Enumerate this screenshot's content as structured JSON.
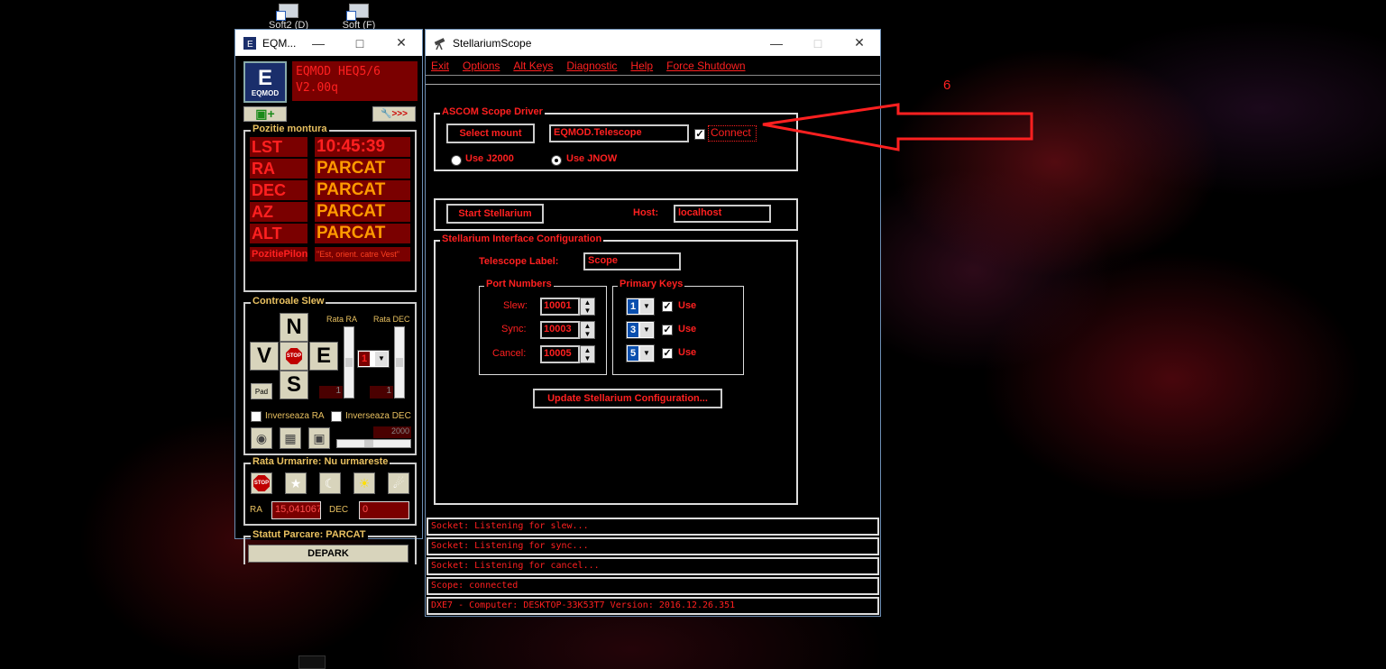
{
  "desktop": {
    "icons": [
      {
        "label": "Soft2 (D)"
      },
      {
        "label": "Soft (F)"
      }
    ],
    "annotation_number": "6",
    "colors": {
      "arrow": "#ff2020"
    }
  },
  "eqmod": {
    "window_title": "EQM...",
    "title_line1": "EQMOD HEQ5/6",
    "title_line2": "V2.00q",
    "logo_letter": "E",
    "logo_label": "EQMOD",
    "settings_btn_label": ">>>",
    "position": {
      "title": "Pozitie montura",
      "rows": [
        {
          "label": "LST",
          "value": "10:45:39"
        },
        {
          "label": "RA",
          "value": "PARCAT"
        },
        {
          "label": "DEC",
          "value": "PARCAT"
        },
        {
          "label": "AZ",
          "value": "PARCAT"
        },
        {
          "label": "ALT",
          "value": "PARCAT"
        }
      ],
      "pier_label": "PozitiePilon",
      "pier_value": "\"Est, orient. catre Vest\""
    },
    "slew": {
      "title": "Controale Slew",
      "n": "N",
      "s": "S",
      "e": "E",
      "w": "V",
      "stop": "STOP",
      "pad": "Pad",
      "rate_ra_label": "Rata RA",
      "rate_dec_label": "Rata DEC",
      "rate_combo_value": "1",
      "rate_ra_value": "1",
      "rate_dec_value": "1",
      "reverse_ra": "Inverseaza RA",
      "reverse_dec": "Inverseaza DEC",
      "slider_value": "2000"
    },
    "tracking": {
      "title": "Rata Urmarire: Nu urmareste",
      "stop": "STOP",
      "ra_label": "RA",
      "ra_value": "15,041067",
      "dec_label": "DEC",
      "dec_value": "0"
    },
    "park": {
      "title": "Statut Parcare: PARCAT",
      "button": "DEPARK"
    }
  },
  "stellarium": {
    "window_title": "StellariumScope",
    "menu": [
      "Exit",
      "Options",
      "Alt Keys",
      "Diagnostic",
      "Help",
      "Force Shutdown"
    ],
    "ascom": {
      "title": "ASCOM Scope Driver",
      "select_mount": "Select mount",
      "driver": "EQMOD.Telescope",
      "connect_label": "Connect",
      "connect_checked": true,
      "j2000": "Use J2000",
      "jnow": "Use JNOW",
      "selected_epoch": "JNOW"
    },
    "start": {
      "button": "Start Stellarium",
      "host_label": "Host:",
      "host_value": "localhost"
    },
    "interface": {
      "title": "Stellarium Interface Configuration",
      "telescope_label": "Telescope Label:",
      "telescope_value": "Scope",
      "ports_title": "Port Numbers",
      "ports": [
        {
          "label": "Slew:",
          "value": "10001"
        },
        {
          "label": "Sync:",
          "value": "10003"
        },
        {
          "label": "Cancel:",
          "value": "10005"
        }
      ],
      "keys_title": "Primary Keys",
      "keys": [
        {
          "value": "1",
          "use_label": "Use"
        },
        {
          "value": "3",
          "use_label": "Use"
        },
        {
          "value": "5",
          "use_label": "Use"
        }
      ],
      "update_button": "Update Stellarium Configuration..."
    },
    "status_lines": [
      "Socket: Listening for slew...",
      "Socket: Listening for sync...",
      "Socket: Listening for cancel...",
      "Scope: connected",
      "DXE7 - Computer: DESKTOP-33K53T7    Version: 2016.12.26.351"
    ]
  }
}
